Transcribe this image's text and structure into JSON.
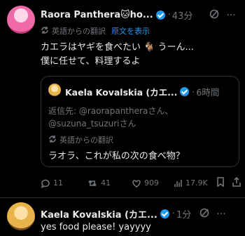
{
  "tweet": {
    "name": "Raora Panthera🐱ho...",
    "time": "43分",
    "translation_label": "英語からの翻訳",
    "show_original": "原文を表示",
    "text_line1": "カエラはヤギを食べたい 🐐 うーん...",
    "text_line2": "僕に任せて、料理するよ"
  },
  "quote": {
    "name": "Kaela Kovalskia (カエ...",
    "time": "6時間",
    "reply_to_line1": "返信先: @raorapantheraさん、",
    "reply_to_line2": "@suzuna_tsuzuriさん",
    "translation_label": "英語からの翻訳",
    "text": "ラオラ、これが私の次の食べ物？"
  },
  "actions": {
    "replies": "11",
    "retweets": "41",
    "likes": "909",
    "views": "17.9K"
  },
  "reply": {
    "name": "Kaela Kovalskia (カエ...",
    "time": "1分",
    "text": "yes food please! yayyyy"
  },
  "colors": {
    "background": "#000000",
    "text": "#e7e9ea",
    "muted": "#71767b",
    "accent": "#1d9bf0"
  }
}
